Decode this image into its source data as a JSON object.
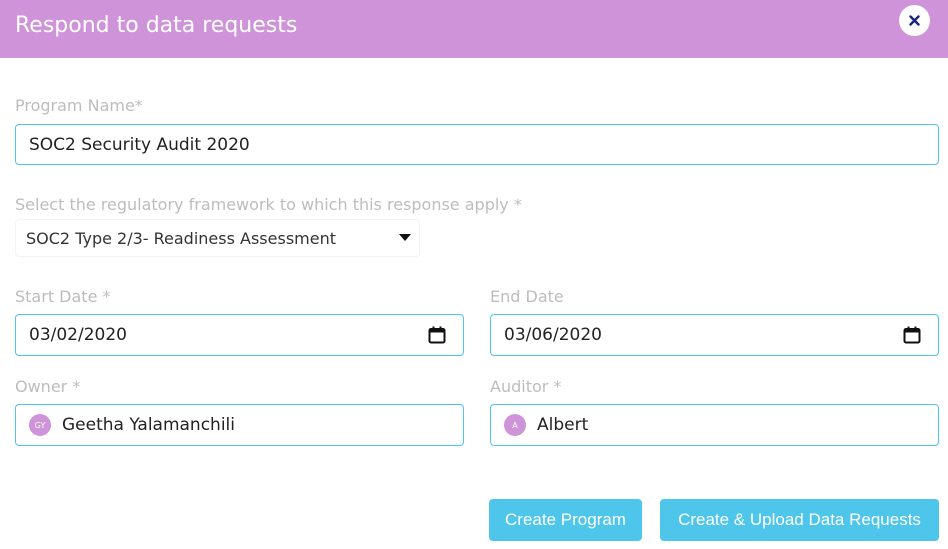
{
  "dialog": {
    "title": "Respond to data requests",
    "close_icon": "close-icon"
  },
  "form": {
    "program_name": {
      "label": "Program Name*",
      "value": "SOC2 Security Audit 2020"
    },
    "framework": {
      "label": "Select the regulatory framework to which this response apply *",
      "selected": "SOC2 Type 2/3- Readiness Assessment"
    },
    "start_date": {
      "label": "Start Date *",
      "value": "03/02/2020"
    },
    "end_date": {
      "label": "End Date",
      "value": "03/06/2020"
    },
    "owner": {
      "label": "Owner *",
      "initials": "GY",
      "name": "Geetha Yalamanchili"
    },
    "auditor": {
      "label": "Auditor *",
      "initials": "A",
      "name": "Albert"
    }
  },
  "actions": {
    "create_program": "Create Program",
    "create_upload": "Create & Upload Data Requests"
  },
  "colors": {
    "header": "#ce93d8",
    "accent_border": "#4fc3f7",
    "button": "#4ec5ea",
    "label": "#bdbdbd"
  }
}
